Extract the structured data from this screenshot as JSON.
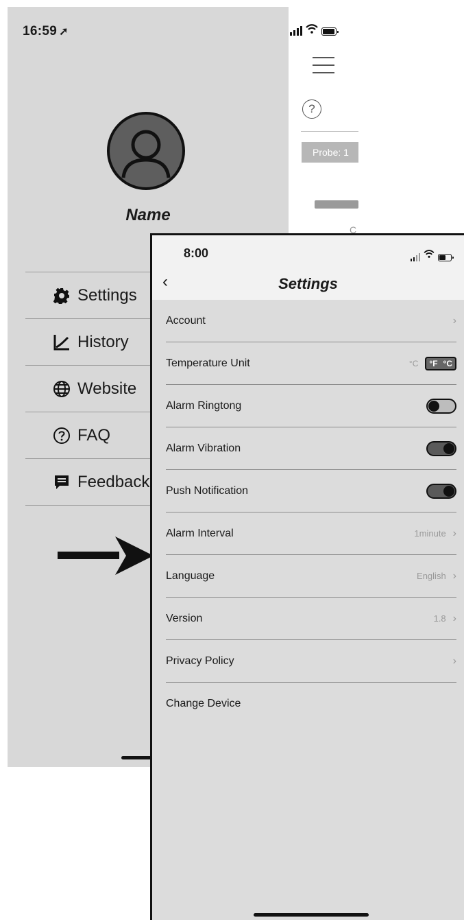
{
  "drawer_screen": {
    "status_bar": {
      "time": "16:59"
    },
    "profile": {
      "name": "Name"
    },
    "menu": [
      {
        "label": "Settings",
        "icon": "gear-icon"
      },
      {
        "label": "History",
        "icon": "chart-icon"
      },
      {
        "label": "Website",
        "icon": "globe-icon"
      },
      {
        "label": "FAQ",
        "icon": "question-icon"
      },
      {
        "label": "Feedback",
        "icon": "feedback-icon"
      }
    ],
    "background_screen": {
      "probe_label": "Probe: 1",
      "partial_text": "C"
    }
  },
  "settings_screen": {
    "status_bar": {
      "time": "8:00"
    },
    "title": "Settings",
    "rows": [
      {
        "label": "Account"
      },
      {
        "label": "Temperature Unit",
        "unit_c": "°C",
        "switch_left": "°F",
        "switch_right": "°C"
      },
      {
        "label": "Alarm Ringtong",
        "toggle": "off"
      },
      {
        "label": "Alarm Vibration",
        "toggle": "on"
      },
      {
        "label": "Push Notification",
        "toggle": "on"
      },
      {
        "label": "Alarm Interval",
        "value": "1minute"
      },
      {
        "label": "Language",
        "value": "English"
      },
      {
        "label": "Version",
        "value": "1.8"
      },
      {
        "label": "Privacy Policy"
      },
      {
        "label": "Change Device"
      }
    ]
  },
  "colors": {
    "drawer_bg": "#d8d8d8",
    "settings_bg": "#dcdcdc",
    "toggle_on": "#5a5a5a"
  }
}
